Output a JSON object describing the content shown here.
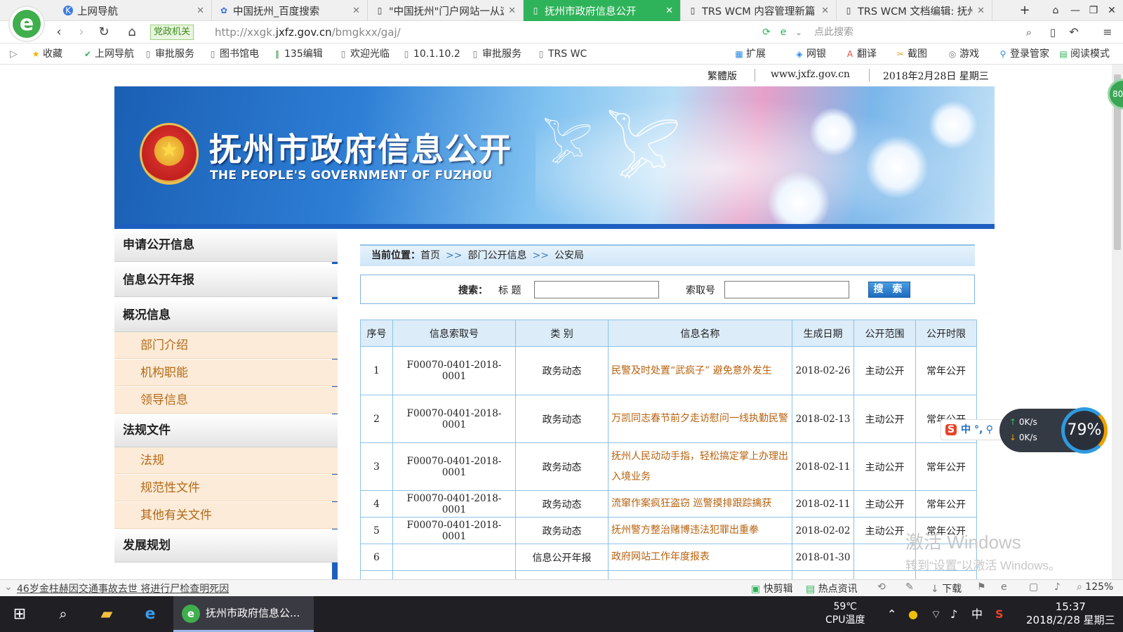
{
  "browser": {
    "tabs": [
      {
        "icon": "k-icon",
        "label": "上网导航",
        "active": false
      },
      {
        "icon": "baidu-paw-icon",
        "label": "中国抚州_百度搜索",
        "active": false
      },
      {
        "icon": "page-icon",
        "label": "\"中国抚州\"门户网站一从这",
        "active": false
      },
      {
        "icon": "page-icon",
        "label": "抚州市政府信息公开",
        "active": true
      },
      {
        "icon": "page-icon",
        "label": "TRS WCM 内容管理新篇",
        "active": false
      },
      {
        "icon": "page-icon",
        "label": "TRS WCM 文档编辑: 抚州",
        "active": false
      }
    ],
    "new_tab": "+",
    "gov_badge": "党政机关",
    "url_prefix": "http://xxgk.",
    "url_domain": "jxfz.gov.cn",
    "url_path": "/bmgkxx/gaj/",
    "search_placeholder": "点此搜索",
    "bookmarks": [
      {
        "icon": "star-icon",
        "label": "收藏"
      },
      {
        "icon": "hao-icon",
        "label": "上网导航"
      },
      {
        "icon": "page-icon",
        "label": "审批服务"
      },
      {
        "icon": "page-icon",
        "label": "图书馆电"
      },
      {
        "icon": "135-icon",
        "label": "135编辑"
      },
      {
        "icon": "page-icon",
        "label": "欢迎光临"
      },
      {
        "icon": "page-icon",
        "label": "10.1.10.2"
      },
      {
        "icon": "page-icon",
        "label": "审批服务"
      },
      {
        "icon": "page-icon",
        "label": "TRS WC"
      }
    ],
    "tools": [
      "扩展",
      "网银",
      "翻译",
      "截图",
      "游戏",
      "登录管家",
      "阅读模式"
    ],
    "side_badge": "80"
  },
  "page": {
    "top_info": {
      "traditional": "繁體版",
      "domain": "www.jxfz.gov.cn",
      "date": "2018年2月28日  星期三"
    },
    "banner": {
      "title": "抚州市政府信息公开",
      "subtitle": "THE PEOPLE'S GOVERNMENT OF FUZHOU"
    },
    "nav": [
      {
        "type": "header",
        "label": "申请公开信息"
      },
      {
        "type": "header",
        "label": "信息公开年报"
      },
      {
        "type": "header",
        "label": "概况信息"
      },
      {
        "type": "sub",
        "label": "部门介绍"
      },
      {
        "type": "sub",
        "label": "机构职能"
      },
      {
        "type": "sub",
        "label": "领导信息"
      },
      {
        "type": "header",
        "label": "法规文件"
      },
      {
        "type": "sub",
        "label": "法规"
      },
      {
        "type": "sub",
        "label": "规范性文件"
      },
      {
        "type": "sub",
        "label": "其他有关文件"
      },
      {
        "type": "header",
        "label": "发展规划"
      }
    ],
    "breadcrumb": {
      "lead": "当前位置：",
      "items": [
        "首页",
        "部门公开信息",
        "公安局"
      ],
      "sep": ">>"
    },
    "search": {
      "label": "搜索：",
      "title_label": "标  题",
      "title_value": "",
      "index_label": "索取号",
      "index_value": "",
      "button": "搜 索"
    },
    "table": {
      "columns": [
        "序号",
        "信息索取号",
        "类 别",
        "信息名称",
        "生成日期",
        "公开范围",
        "公开时限"
      ],
      "rows": [
        [
          "1",
          "F00070-0401-2018-0001",
          "政务动态",
          "民警及时处置“武疯子” 避免意外发生",
          "2018-02-26",
          "主动公开",
          "常年公开"
        ],
        [
          "2",
          "F00070-0401-2018-0001",
          "政务动态",
          "万凯同志春节前夕走访慰问一线执勤民警",
          "2018-02-13",
          "主动公开",
          "常年公开"
        ],
        [
          "3",
          "F00070-0401-2018-0001",
          "政务动态",
          "抚州人民动动手指，轻松搞定掌上办理出入境业务",
          "2018-02-11",
          "主动公开",
          "常年公开"
        ],
        [
          "4",
          "F00070-0401-2018-0001",
          "政务动态",
          "流窜作案疯狂盗窃 巡警摸排跟踪擒获",
          "2018-02-11",
          "主动公开",
          "常年公开"
        ],
        [
          "5",
          "F00070-0401-2018-0001",
          "政务动态",
          "抚州警方整治赌博违法犯罪出重拳",
          "2018-02-02",
          "主动公开",
          "常年公开"
        ],
        [
          "6",
          "",
          "信息公开年报",
          "政府网站工作年度报表",
          "2018-01-30",
          "",
          ""
        ]
      ]
    },
    "watermark": {
      "line1": "激活 Windows",
      "line2": "转到“设置”以激活 Windows。"
    }
  },
  "widgets": {
    "ime": "中 °,",
    "ime_logo": "S",
    "speed_up": "0K/s",
    "speed_down": "0K/s",
    "speed_pct": "79%"
  },
  "statusbar": {
    "news": "46岁金柱赫因交通事故去世 将进行尸检查明死因",
    "items": [
      "快剪辑",
      "热点资讯",
      "下载"
    ],
    "zoom": "125%"
  },
  "taskbar": {
    "app_label": "抚州市政府信息公...",
    "cpu_temp": "59℃",
    "cpu_label": "CPU温度",
    "ime": "中",
    "time": "15:37",
    "date": "2018/2/28 星期三"
  }
}
